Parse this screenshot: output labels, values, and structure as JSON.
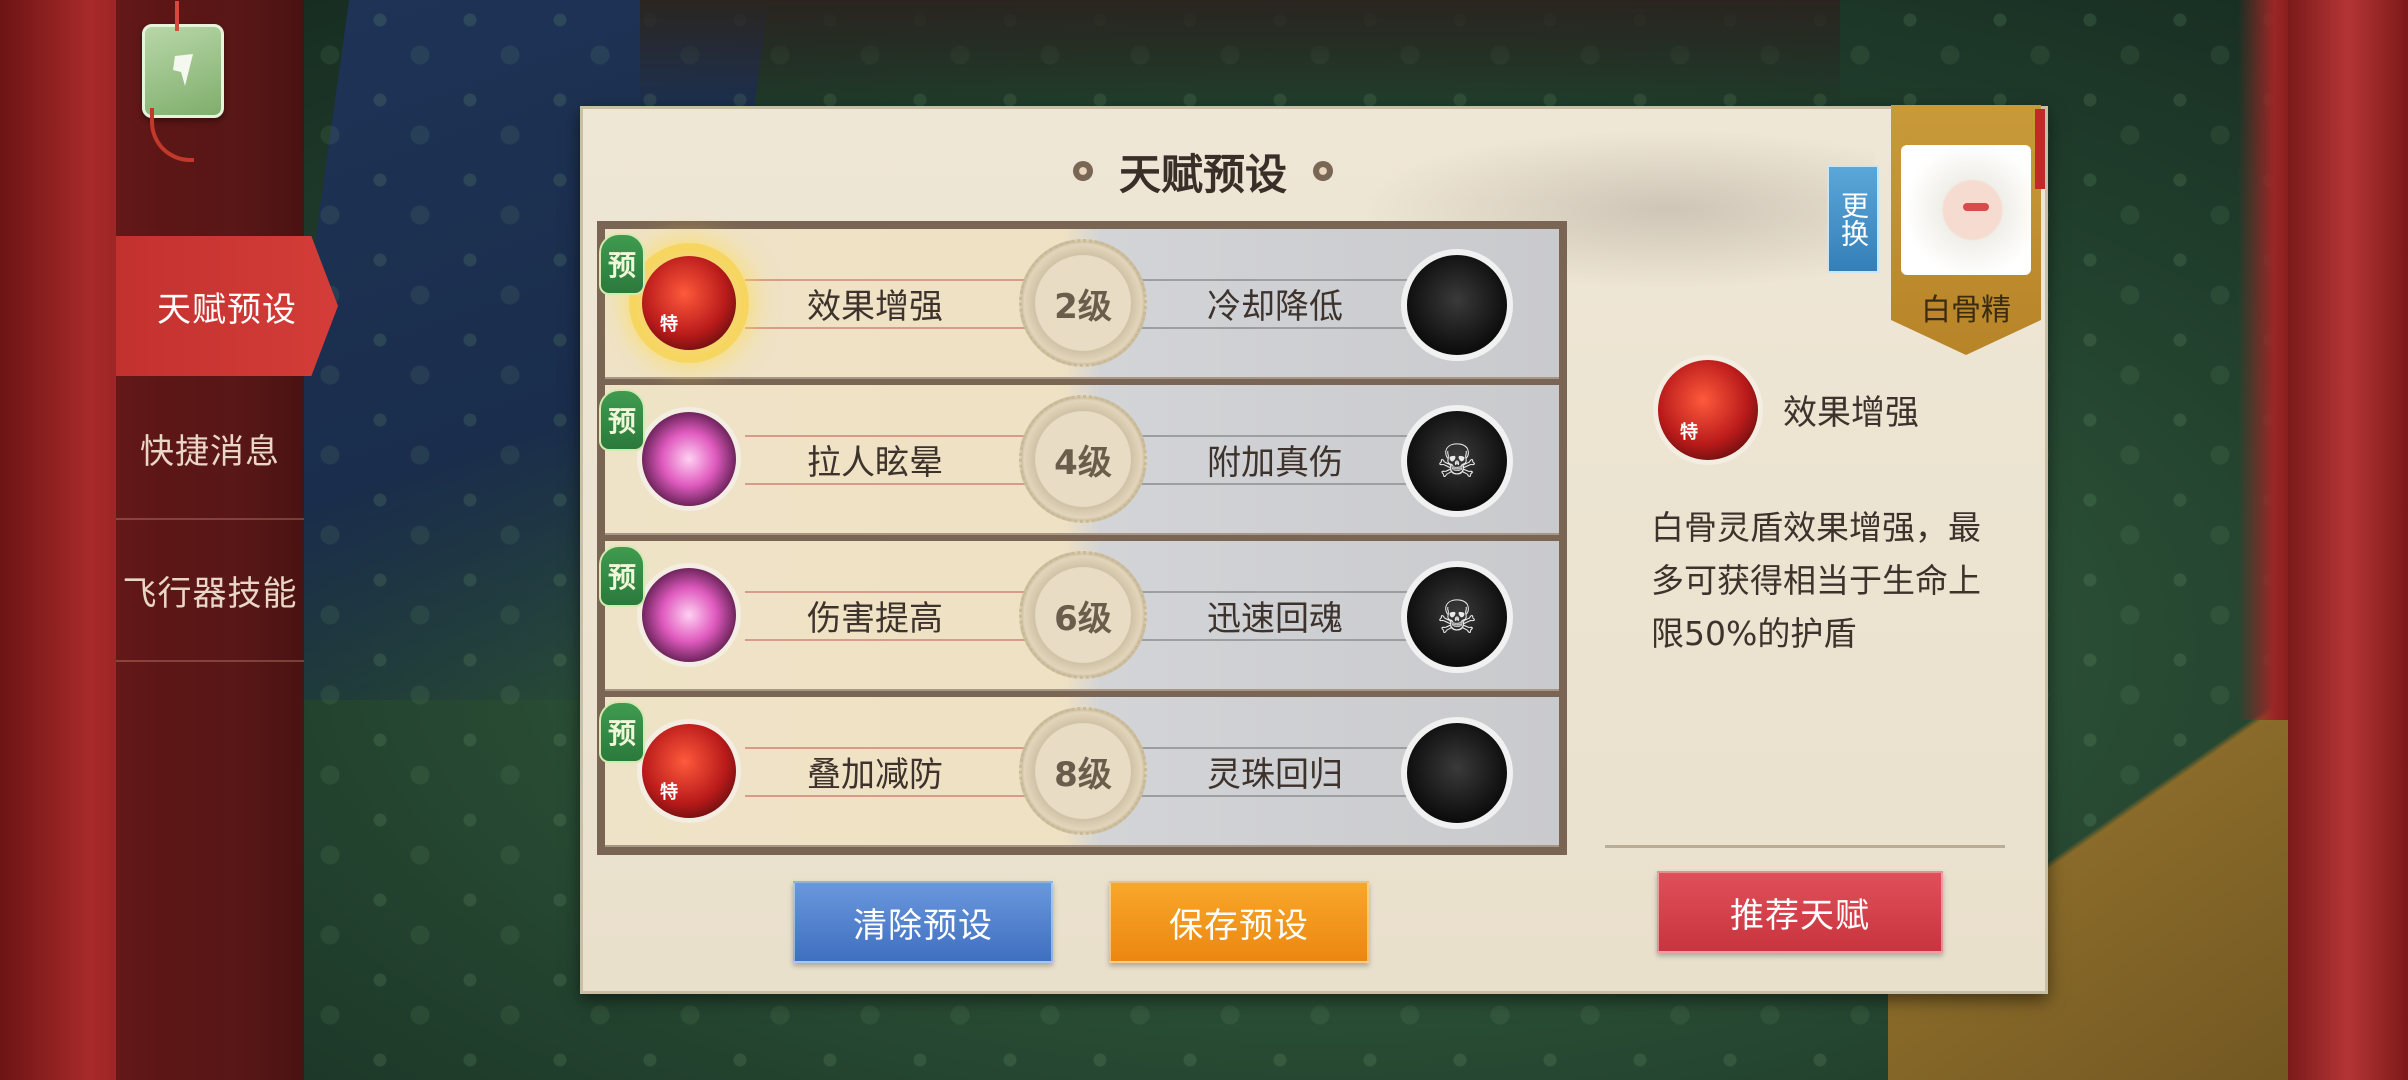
{
  "nav": {
    "items": [
      {
        "label": "天赋预设",
        "active": true
      },
      {
        "label": "快捷消息",
        "active": false
      },
      {
        "label": "飞行器技能",
        "active": false
      }
    ]
  },
  "panel": {
    "title": "天赋预设"
  },
  "talents": {
    "preset_badge": "预",
    "special_badge": "特",
    "rows": [
      {
        "left_name": "效果增强",
        "level": "2级",
        "right_name": "冷却降低",
        "left_icon": "red-flame-icon",
        "right_icon": "dark-orb-icon",
        "selected": true
      },
      {
        "left_name": "拉人眩晕",
        "level": "4级",
        "right_name": "附加真伤",
        "left_icon": "pink-lotus-icon",
        "right_icon": "skull-icon",
        "selected": false
      },
      {
        "left_name": "伤害提高",
        "level": "6级",
        "right_name": "迅速回魂",
        "left_icon": "pink-lotus-icon",
        "right_icon": "skull-icon",
        "selected": false
      },
      {
        "left_name": "叠加减防",
        "level": "8级",
        "right_name": "灵珠回归",
        "left_icon": "red-flame-icon",
        "right_icon": "dark-orb-icon",
        "selected": false
      }
    ]
  },
  "buttons": {
    "clear": "清除预设",
    "save": "保存预设",
    "recommend": "推荐天赋"
  },
  "detail": {
    "name": "效果增强",
    "description": "白骨灵盾效果增强，最多可获得相当于生命上限50%的护盾"
  },
  "character": {
    "name": "白骨精",
    "swap_label": "更换"
  },
  "colors": {
    "nav_active": "#c3312f",
    "btn_blue": "#4f80cc",
    "btn_orange": "#f29a1c",
    "btn_red": "#d3404a",
    "preset_badge": "#2f8a43"
  }
}
